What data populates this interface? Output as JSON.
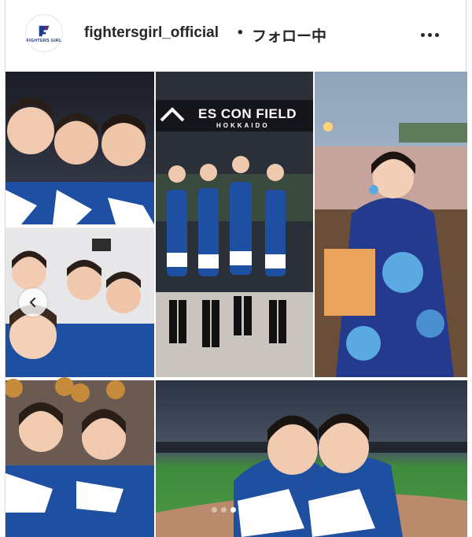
{
  "header": {
    "avatar_brand": "FIGHTERS GIRL",
    "account_name": "fightersgirl_official",
    "separator": "•",
    "follow_status": "フォロー中"
  },
  "photos": {
    "stadium_sign": "ES CON FIELD",
    "stadium_sign_sub": "HOKKAIDO"
  },
  "carousel": {
    "total_dots": 4,
    "active_index": 2
  },
  "icons": {
    "more": "more-options-icon",
    "prev": "chevron-left-icon"
  }
}
